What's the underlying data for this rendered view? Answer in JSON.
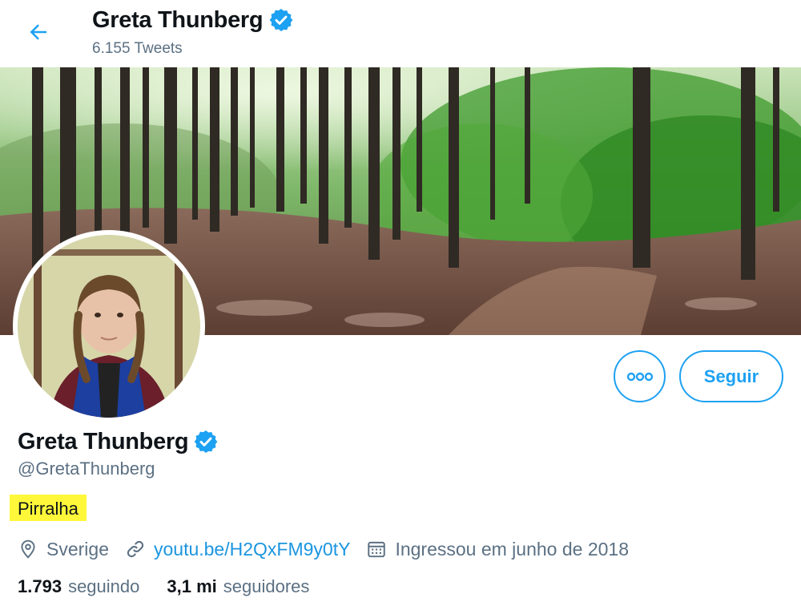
{
  "header": {
    "name": "Greta Thunberg",
    "tweet_count": "6.155 Tweets"
  },
  "profile": {
    "name": "Greta Thunberg",
    "handle": "@GretaThunberg",
    "bio": "Pirralha",
    "location": "Sverige",
    "website": "youtu.be/H2QxFM9y0tY",
    "joined": "Ingressou em junho de 2018",
    "following_count": "1.793",
    "following_label": "seguindo",
    "followers_count": "3,1 mi",
    "followers_label": "seguidores"
  },
  "actions": {
    "follow_label": "Seguir"
  },
  "icons": {
    "back": "back-arrow-icon",
    "verified": "verified-badge-icon",
    "more": "more-dots-icon",
    "location": "location-pin-icon",
    "link": "link-icon",
    "calendar": "calendar-icon"
  },
  "colors": {
    "accent": "#1da1f2",
    "link": "#1b95e0",
    "secondary_text": "#5b7083",
    "bio_highlight": "#fff83a"
  }
}
